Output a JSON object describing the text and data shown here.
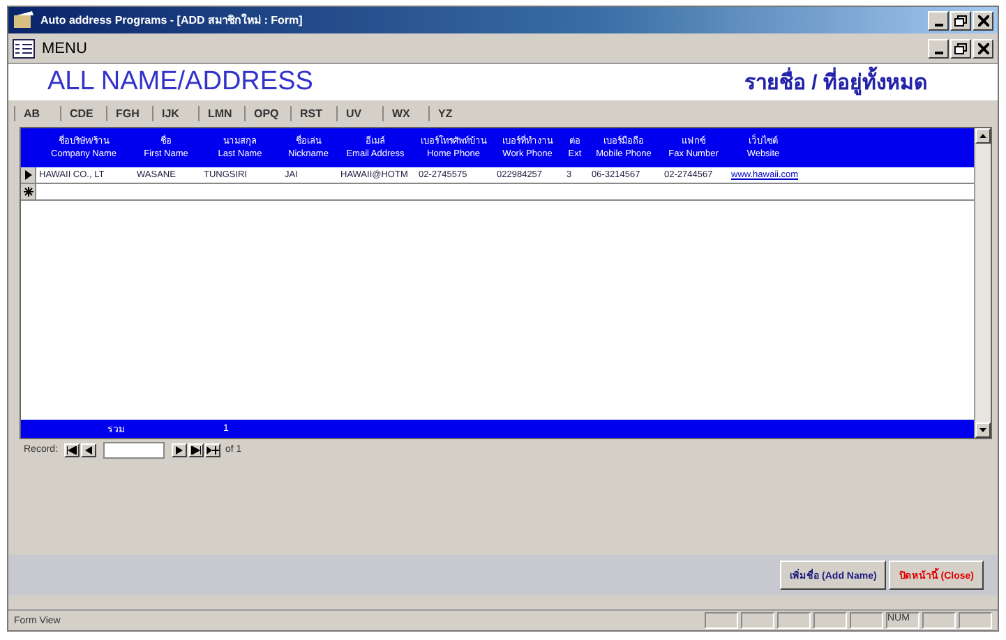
{
  "window": {
    "title": "Auto address Programs - [ADD สมาชิกใหม่ : Form]"
  },
  "menu_bar": {
    "label": "MENU"
  },
  "header": {
    "title": "ALL NAME/ADDRESS",
    "thai_title": "รายชื่อ / ที่อยู่ทั้งหมด"
  },
  "letter_tabs": [
    "AB",
    "CDE",
    "FGH",
    "IJK",
    "LMN",
    "OPQ",
    "RST",
    "UV",
    "WX",
    "YZ"
  ],
  "table": {
    "columns": [
      {
        "thai": "ชื่อบริษัท/ร้าน",
        "label": "Company Name"
      },
      {
        "thai": "ชื่อ",
        "label": "First Name"
      },
      {
        "thai": "นามสกุล",
        "label": "Last Name"
      },
      {
        "thai": "ชื่อเล่น",
        "label": "Nickname"
      },
      {
        "thai": "อีเมล์",
        "label": "Email Address"
      },
      {
        "thai": "เบอร์โทรศัพท์บ้าน",
        "label": "Home Phone"
      },
      {
        "thai": "เบอร์ที่ทำงาน",
        "label": "Work Phone"
      },
      {
        "thai": "ต่อ",
        "label": "Ext"
      },
      {
        "thai": "เบอร์มือถือ",
        "label": "Mobile Phone"
      },
      {
        "thai": "แฟกซ์",
        "label": "Fax Number"
      },
      {
        "thai": "เว็บไซต์",
        "label": "Website"
      }
    ],
    "rows": [
      {
        "current": true,
        "cells": [
          "HAWAII CO., LT",
          "WASANE",
          "TUNGSIRI",
          "JAI",
          "HAWAII@HOTM",
          "02-2745575",
          "022984257",
          "3",
          "06-3214567",
          "02-2744567",
          "www.hawaii.com"
        ]
      }
    ],
    "footer": {
      "label": "รวม",
      "count": "1"
    }
  },
  "record_nav": {
    "label": "Record:",
    "of": "of 1"
  },
  "buttons": [
    {
      "label": "เพิ่มชื่อ (Add Name)",
      "kind": "add"
    },
    {
      "label": "ปิดหน้านี้ (Close)",
      "kind": "close"
    }
  ],
  "status_bar": {
    "mode": "Form View",
    "indicator": "NUM"
  }
}
